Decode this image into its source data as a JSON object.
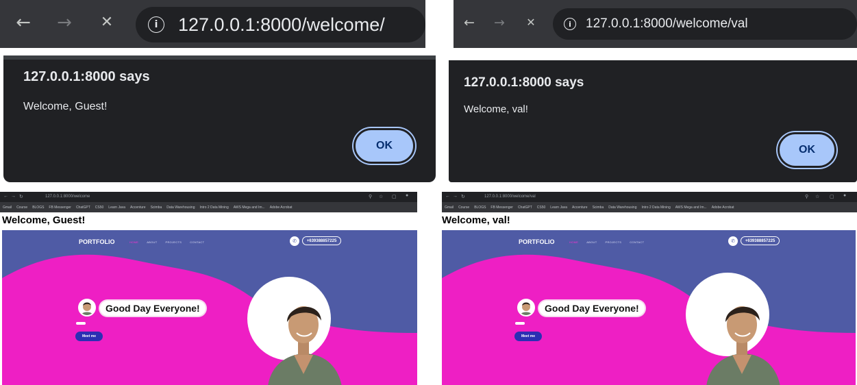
{
  "left": {
    "address": {
      "url": "127.0.0.1:8000/welcome/"
    },
    "dialog": {
      "title": "127.0.0.1:8000 says",
      "message": "Welcome, Guest!",
      "ok_label": "OK"
    },
    "browser": {
      "url": "127.0.0.1:8000/welcome"
    },
    "page_heading": "Welcome, Guest!"
  },
  "right": {
    "address": {
      "url": "127.0.0.1:8000/welcome/val"
    },
    "dialog": {
      "title": "127.0.0.1:8000 says",
      "message": "Welcome, val!",
      "ok_label": "OK"
    },
    "browser": {
      "url": "127.0.0.1:8000/welcome/val"
    },
    "page_heading": "Welcome, val!"
  },
  "bookmarks": [
    "Gmail",
    "Course",
    "BLOGS",
    "FB Messenger",
    "ChatGPT",
    "CS50",
    "Learn Java",
    "Accenture",
    "Scimba",
    "Data Warehousing",
    "Intro 2 Data Mining",
    "AWS Mega and Im...",
    "Adobe Acrobat"
  ],
  "site": {
    "brand": "PORTFOLIO",
    "menu": [
      "HOME",
      "ABOUT",
      "PROJECTS",
      "CONTACT"
    ],
    "phone": "+639388857225",
    "greeting": "Good Day Everyone!",
    "cta": "Meet me"
  },
  "icons": {
    "back": "←",
    "forward": "→",
    "close": "✕",
    "info": "i",
    "phone": "✆"
  },
  "colors": {
    "chrome_dark": "#35363a",
    "omnibox": "#202124",
    "ok_button": "#a8c7fa",
    "site_blue": "#4f5ba5",
    "site_magenta": "#ee1fc4"
  }
}
